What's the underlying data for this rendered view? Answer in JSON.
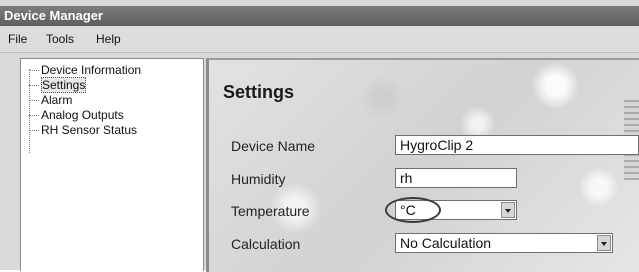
{
  "window": {
    "title": "Device Manager"
  },
  "menubar": {
    "items": [
      "File",
      "Tools",
      "Help"
    ]
  },
  "tree": {
    "items": [
      {
        "label": "Device Information",
        "selected": false
      },
      {
        "label": "Settings",
        "selected": true
      },
      {
        "label": "Alarm",
        "selected": false
      },
      {
        "label": "Analog Outputs",
        "selected": false
      },
      {
        "label": "RH Sensor Status",
        "selected": false
      }
    ]
  },
  "settings": {
    "heading": "Settings",
    "fields": {
      "device_name": {
        "label": "Device Name",
        "value": "HygroClip 2"
      },
      "humidity": {
        "label": "Humidity",
        "value": "rh"
      },
      "temperature": {
        "label": "Temperature",
        "value": "°C"
      },
      "calculation": {
        "label": "Calculation",
        "value": "No Calculation"
      }
    }
  },
  "icons": [
    "chevron-down-icon"
  ]
}
